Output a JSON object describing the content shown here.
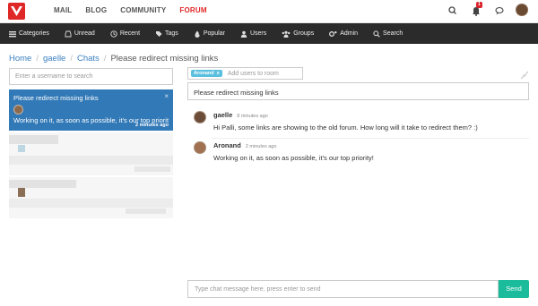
{
  "topnav": {
    "items": [
      {
        "label": "MAIL"
      },
      {
        "label": "BLOG"
      },
      {
        "label": "COMMUNITY"
      },
      {
        "label": "FORUM",
        "active": true
      }
    ],
    "notification_count": "1"
  },
  "catnav": {
    "items": [
      {
        "label": "Categories",
        "icon": "list-icon"
      },
      {
        "label": "Unread",
        "icon": "inbox-icon"
      },
      {
        "label": "Recent",
        "icon": "clock-icon"
      },
      {
        "label": "Tags",
        "icon": "tags-icon"
      },
      {
        "label": "Popular",
        "icon": "fire-icon"
      },
      {
        "label": "Users",
        "icon": "user-icon"
      },
      {
        "label": "Groups",
        "icon": "groups-icon"
      },
      {
        "label": "Admin",
        "icon": "cogs-icon"
      },
      {
        "label": "Search",
        "icon": "search-icon"
      }
    ]
  },
  "breadcrumb": {
    "items": [
      "Home",
      "gaelle",
      "Chats"
    ],
    "current": "Please redirect missing links"
  },
  "sidebar": {
    "search_placeholder": "Enter a username to search",
    "active_chat": {
      "title": "Please redirect missing links",
      "preview": "Working on it, as soon as possible, it's our top priority!",
      "time": "2 minutes ago",
      "close": "×"
    }
  },
  "room": {
    "user_tag": "Aronand",
    "user_tag_remove": "x",
    "add_users_placeholder": "Add users to room",
    "name": "Please redirect missing links"
  },
  "messages": [
    {
      "author": "gaelle",
      "time": "8 minutes ago",
      "text": "Hi Palli, some links are showing to the old forum. How long will it take to redirect them? :)"
    },
    {
      "author": "Aronand",
      "time": "2 minutes ago",
      "text": "Working on it, as soon as possible, it's our top priority!"
    }
  ],
  "composer": {
    "placeholder": "Type chat message here, press enter to send",
    "send_label": "Send"
  },
  "colors": {
    "brand": "#e02727",
    "active_chat": "#3279b7",
    "send": "#1abc9c",
    "navbar": "#2b2b2b",
    "link": "#3a80c1"
  }
}
